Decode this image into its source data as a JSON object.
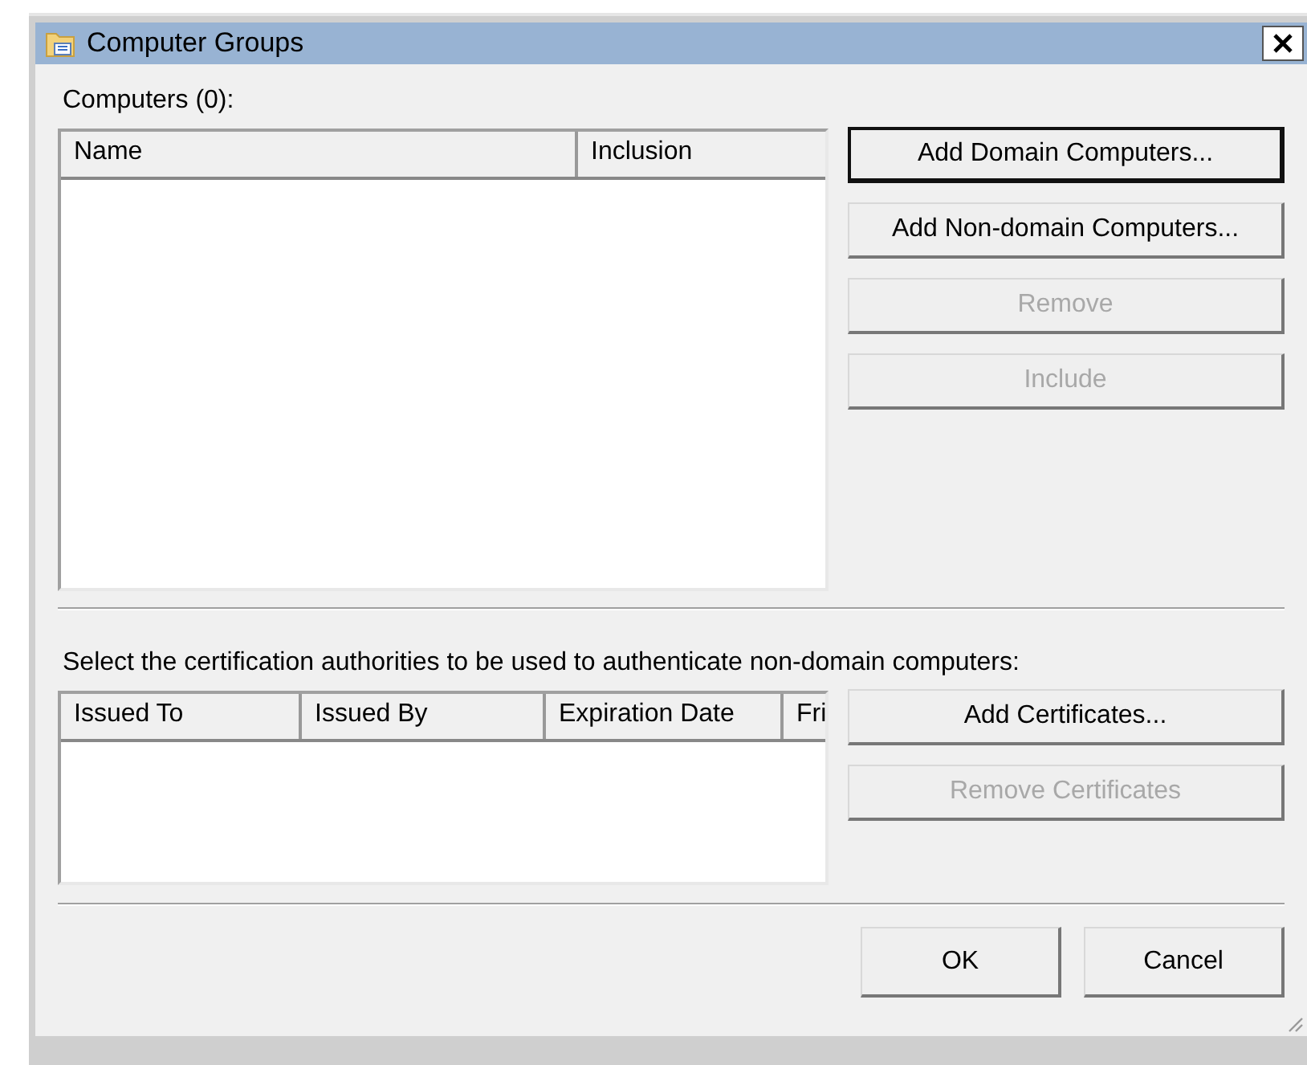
{
  "window": {
    "title": "Computer Groups"
  },
  "computers": {
    "label": "Computers (0):",
    "columns": [
      "Name",
      "Inclusion"
    ],
    "buttons": [
      {
        "label": "Add Domain Computers...",
        "disabled": false,
        "default": true
      },
      {
        "label": "Add Non-domain Computers...",
        "disabled": false,
        "default": false
      },
      {
        "label": "Remove",
        "disabled": true,
        "default": false
      },
      {
        "label": "Include",
        "disabled": true,
        "default": false
      }
    ]
  },
  "certificates": {
    "label": "Select the certification authorities to be used to authenticate non-domain computers:",
    "columns": [
      "Issued To",
      "Issued By",
      "Expiration Date",
      "Fri"
    ],
    "buttons": [
      {
        "label": "Add Certificates...",
        "disabled": false,
        "default": false
      },
      {
        "label": "Remove Certificates",
        "disabled": true,
        "default": false
      }
    ]
  },
  "footer_buttons": [
    "OK",
    "Cancel"
  ]
}
